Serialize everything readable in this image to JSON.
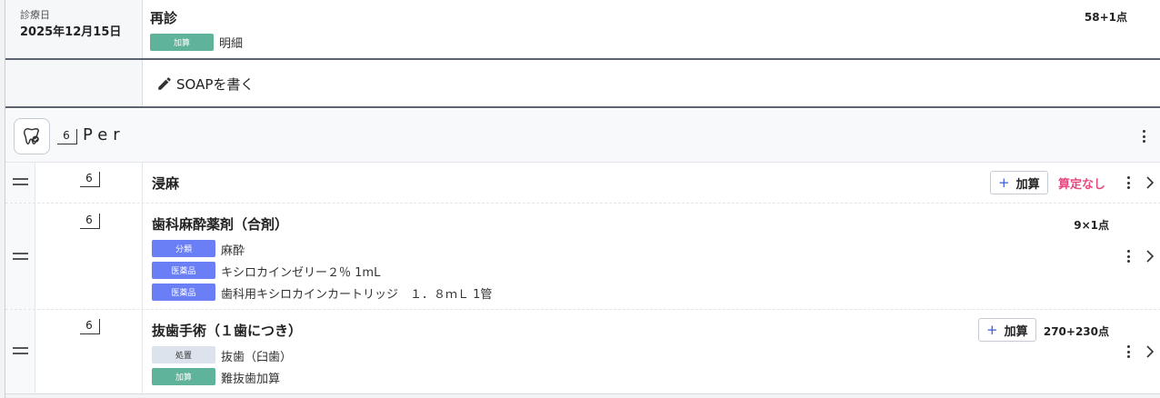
{
  "visit": {
    "date_label": "診療日",
    "date": "2025年12月15日",
    "title": "再診",
    "tag": "加算",
    "detail_link": "明細",
    "points": "58+1点"
  },
  "soap": {
    "button_label": "SOAPを書く",
    "icon": "pencil-icon"
  },
  "group": {
    "tooth_number": "6",
    "title": "Per",
    "icon": "tooth-icon"
  },
  "items": [
    {
      "tooth_number": "6",
      "title": "浸麻",
      "add_button": "加算",
      "status": "算定なし"
    },
    {
      "tooth_number": "6",
      "title": "歯科麻酔薬剤（合剤）",
      "points": "9×1点",
      "details": [
        {
          "tag": "分類",
          "text": "麻酔"
        },
        {
          "tag": "医薬品",
          "text": "キシロカインゼリー２％ 1mL"
        },
        {
          "tag": "医薬品",
          "text": "歯科用キシロカインカートリッジ　１．８ｍＬ 1管"
        }
      ]
    },
    {
      "tooth_number": "6",
      "title": "抜歯手術（１歯につき）",
      "add_button": "加算",
      "points": "270+230点",
      "details": [
        {
          "tag": "処置",
          "text": "抜歯（臼歯）"
        },
        {
          "tag": "加算",
          "text": "難抜歯加算"
        }
      ]
    }
  ],
  "colors": {
    "accent_blue": "#3b5bdb",
    "tag_green": "#5fb39a",
    "tag_blue": "#6a7ff5",
    "warning_pink": "#e64980"
  }
}
